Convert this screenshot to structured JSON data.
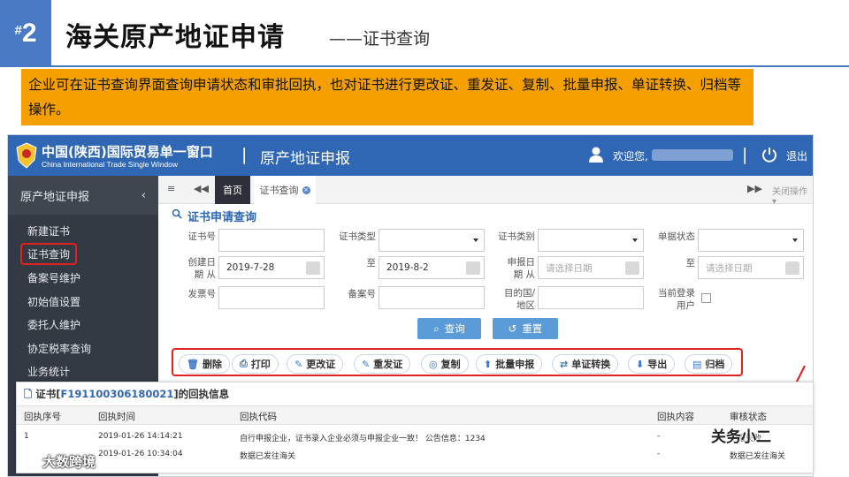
{
  "slide": {
    "badge_hash": "#",
    "badge_num": "2",
    "title": "海关原产地证申请",
    "subtitle": "——证书查询",
    "description": "企业可在证书查询界面查询申请状态和审批回执，也对证书进行更改证、重发证、复制、批量申报、单证转换、归档等操作。"
  },
  "app": {
    "brand_cn": "中国(陕西)国际贸易单一窗口",
    "brand_en": "China International Trade Single Window",
    "separator": "|",
    "system_title": "原产地证申报",
    "welcome": "欢迎您,",
    "logout": "退出"
  },
  "sidebar": {
    "header": "原产地证申报",
    "collapse": "‹",
    "items": [
      "新建证书",
      "证书查询",
      "备案号维护",
      "初始值设置",
      "委托人维护",
      "协定税率查询",
      "业务统计"
    ]
  },
  "tabs": {
    "menu": "≡",
    "prev": "◀◀",
    "home": "首页",
    "current": "证书查询",
    "close_x": "×",
    "next": "▶▶",
    "close_ops": "关闭操作 ▾"
  },
  "search": {
    "title": "证书申请查询",
    "cert_no_label": "证书号",
    "cert_type_label": "证书类型",
    "cert_category_label": "证书类别",
    "doc_status_label": "单据状态",
    "created_label": "创建日期 从",
    "created_from": "2019-7-28",
    "to_label": "至",
    "created_to": "2019-8-2",
    "apply_label": "申报日期 从",
    "date_placeholder": "请选择日期",
    "invoice_label": "发票号",
    "record_label": "备案号",
    "dest_label": "目的国/地区",
    "current_user_label": "当前登录用户",
    "query_button": "查询",
    "reset_button": "重置"
  },
  "operations": [
    "删除",
    "打印",
    "更改证",
    "重发证",
    "复制",
    "批量申报",
    "单证转换",
    "导出",
    "归档"
  ],
  "receipt": {
    "title_prefix": "证书[",
    "cert_no": "F191100306180021",
    "title_suffix": "]的回执信息",
    "columns": [
      "回执序号",
      "回执时间",
      "回执代码",
      "回执内容",
      "审核状态"
    ],
    "rows": [
      [
        "1",
        "2019-01-26 14:14:21",
        "自行申报企业，证书录入企业必须与申报企业一致！ 公告信息：1234",
        "-",
        "申报失败"
      ],
      [
        "",
        "2019-01-26 10:34:04",
        "数据已发往海关",
        "-",
        "数据已发往海关"
      ]
    ]
  },
  "watermarks": {
    "left": "大数跨境",
    "right": "关务小二"
  },
  "colors": {
    "brand_blue": "#2f67b4",
    "highlight_orange": "#f5a000",
    "annotation_red": "#e0211d",
    "sidebar_dark": "#333a44"
  }
}
